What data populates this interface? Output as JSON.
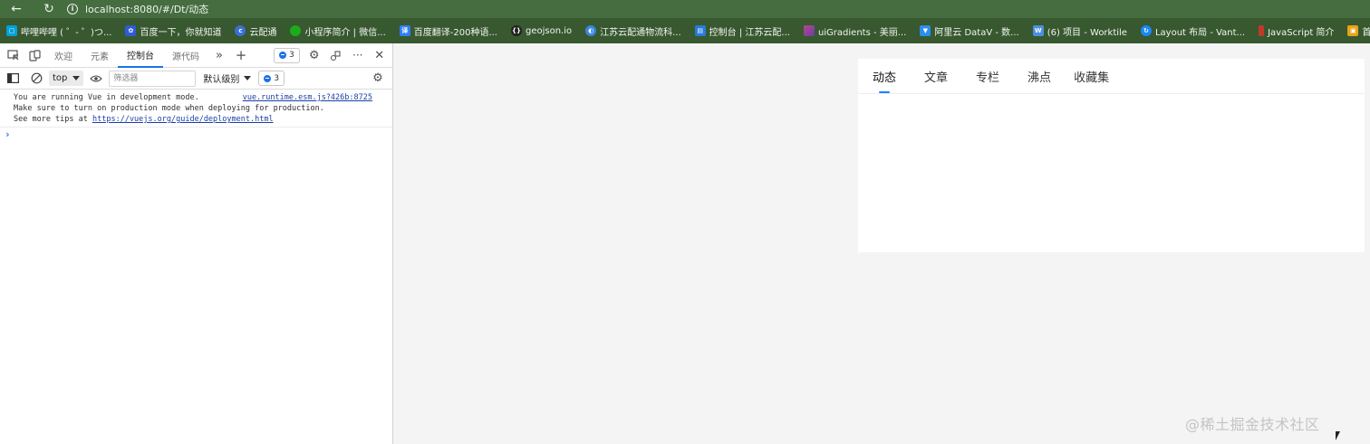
{
  "browser": {
    "url": "localhost:8080/#/Dt/动态",
    "bookmarks": [
      {
        "label": "哔哩哔哩 ( ゜- ゜)つ...",
        "icon": "bilibili-icon",
        "color": "#00a1d6"
      },
      {
        "label": "百度一下，你就知道",
        "icon": "baidu-icon",
        "color": "#2f5cd6"
      },
      {
        "label": "云配通",
        "icon": "cloud-icon",
        "color": "#3b6fd6"
      },
      {
        "label": "小程序简介 | 微信...",
        "icon": "wechat-icon",
        "color": "#1aad19"
      },
      {
        "label": "百度翻译-200种语...",
        "icon": "translate-icon",
        "color": "#2d7ff9"
      },
      {
        "label": "geojson.io",
        "icon": "geojson-icon",
        "color": "#222222"
      },
      {
        "label": "江苏云配通物流科...",
        "icon": "logistics-icon",
        "color": "#3a86e0"
      },
      {
        "label": "控制台 | 江苏云配...",
        "icon": "console-icon",
        "color": "#2a7ad9"
      },
      {
        "label": "uiGradients - 美丽...",
        "icon": "gradient-icon",
        "color": "#b5478f"
      },
      {
        "label": "阿里云 DataV - 数...",
        "icon": "datav-icon",
        "color": "#2b8ef0"
      },
      {
        "label": "(6) 项目 - Worktile",
        "icon": "worktile-icon",
        "color": "#4a90e2"
      },
      {
        "label": "Layout 布局 - Vant...",
        "icon": "vant-icon",
        "color": "#1989fa"
      },
      {
        "label": "JavaScript 简介",
        "icon": "javascript-icon",
        "color": "#c0392b"
      },
      {
        "label": "首页 - 前端面试题...",
        "icon": "interview-icon",
        "color": "#e8a317"
      },
      {
        "label": "",
        "icon": "medium-icon",
        "color": "#111111"
      }
    ]
  },
  "devtools": {
    "tabs": [
      "欢迎",
      "元素",
      "控制台",
      "源代码"
    ],
    "active_tab": "控制台",
    "issues_count": "3",
    "toolbar": {
      "context": "top",
      "filter_placeholder": "筛选器",
      "level": "默认级别",
      "issues_count": "3"
    },
    "console": {
      "line1": "You are running Vue in development mode.",
      "source": "vue.runtime.esm.js?426b:8725",
      "line2": "Make sure to turn on production mode when deploying for production.",
      "line3_prefix": "See more tips at ",
      "line3_link": "https://vuejs.org/guide/deployment.html",
      "prompt": "›"
    }
  },
  "page": {
    "tabs": [
      "动态",
      "文章",
      "专栏",
      "沸点",
      "收藏集"
    ],
    "active_tab": "动态",
    "accent_color": "#1e80ff"
  },
  "watermark": "@稀土掘金技术社区"
}
